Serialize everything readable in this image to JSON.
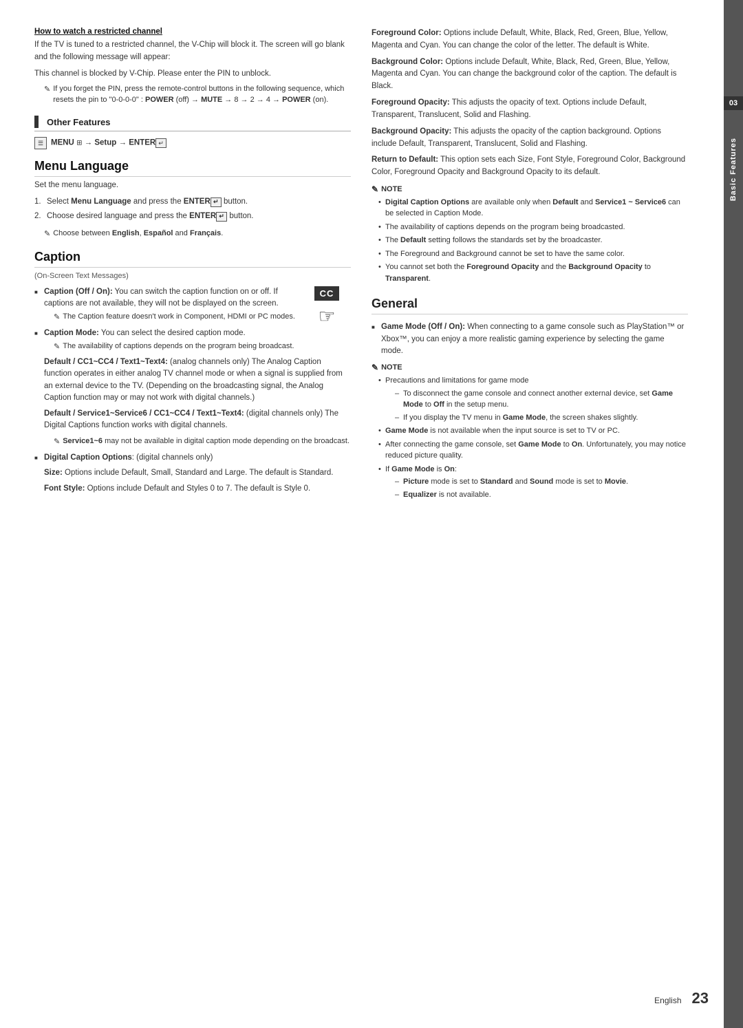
{
  "page": {
    "number": "23",
    "lang": "English",
    "chapter_number": "03",
    "chapter_title": "Basic Features"
  },
  "left_column": {
    "how_to_watch": {
      "heading": "How to watch a restricted channel",
      "para1": "If the TV is tuned to a restricted channel, the V-Chip will block it. The screen will go blank and the following message will appear:",
      "para2": "This channel is blocked by V-Chip. Please enter the PIN to unblock.",
      "note": "If you forget the PIN, press the remote-control buttons in the following sequence, which resets the pin to \"0-0-0-0\" : POWER (off) → MUTE → 8 → 2 → 4 → POWER (on)."
    },
    "other_features": {
      "title": "Other Features",
      "menu_nav": "MENU  → Setup → ENTER"
    },
    "menu_language": {
      "title": "Menu Language",
      "divider": true,
      "intro": "Set the menu language.",
      "steps": [
        {
          "number": "1",
          "text": "Select Menu Language and press the ENTER",
          "suffix": "button."
        },
        {
          "number": "2",
          "text": "Choose desired language and press the ENTER",
          "suffix": "button."
        }
      ],
      "note": "Choose between English, Español and Français."
    },
    "caption": {
      "title": "Caption",
      "subtitle": "(On-Screen Text Messages)",
      "items": [
        {
          "bold_part": "Caption (Off / On):",
          "text": " You can switch the caption function on or off. If captions are not available, they will not be displayed on the screen.",
          "note": "The Caption feature doesn't work in Component, HDMI or PC modes."
        },
        {
          "bold_part": "Caption Mode:",
          "text": " You can select the desired caption mode.",
          "note": "The availability of captions depends on the program being broadcast.",
          "extra_paras": [
            {
              "bold": "Default / CC1~CC4 / Text1~Text4:",
              "text": " (analog channels only) The Analog Caption function operates in either analog TV channel mode or when a signal is supplied from an external device to the TV. (Depending on the broadcasting signal, the Analog Caption function may or may not work with digital channels.)"
            },
            {
              "bold": "Default / Service1~Service6 / CC1~CC4 / Text1~Text4:",
              "text": " (digital channels only) The Digital Captions function works with digital channels.",
              "note2": "Service1~6 may not be available in digital caption mode depending on the broadcast."
            }
          ]
        },
        {
          "bold_part": "Digital Caption Options:",
          "text": " (digital channels only)",
          "extra_paras": [
            {
              "bold": "Size:",
              "text": " Options include Default, Small, Standard and Large. The default is Standard."
            },
            {
              "bold": "Font Style:",
              "text": " Options include Default and Styles 0 to 7. The default is Style 0."
            }
          ]
        }
      ],
      "cc_icon": {
        "label": "CC",
        "hand": "☞"
      }
    }
  },
  "right_column": {
    "caption_continued": {
      "paragraphs": [
        {
          "bold": "Foreground Color:",
          "text": " Options include Default, White, Black, Red, Green, Blue, Yellow, Magenta and Cyan. You can change the color of the letter. The default is White."
        },
        {
          "bold": "Background Color:",
          "text": " Options include Default, White, Black, Red, Green, Blue, Yellow, Magenta and Cyan. You can change the background color of the caption. The default is Black."
        },
        {
          "bold": "Foreground Opacity:",
          "text": " This adjusts the opacity of text. Options include Default, Transparent, Translucent, Solid and Flashing."
        },
        {
          "bold": "Background Opacity:",
          "text": " This adjusts the opacity of the caption background. Options include Default, Transparent, Translucent, Solid and Flashing."
        },
        {
          "bold": "Return to Default:",
          "text": " This option sets each Size, Font Style, Foreground Color, Background Color, Foreground Opacity and Background Opacity to its default."
        }
      ],
      "note_label": "NOTE",
      "notes": [
        {
          "text": "Digital Caption Options are available only when ",
          "bold_inline": "Default",
          "text2": " and ",
          "bold_inline2": "Service1 ~ Service6",
          "text3": " can be selected in Caption Mode."
        },
        {
          "text": "The availability of captions depends on the program being broadcasted."
        },
        {
          "text": "The ",
          "bold_inline": "Default",
          "text2": " setting follows the standards set by the broadcaster."
        },
        {
          "text": "The Foreground and Background cannot be set to have the same color."
        },
        {
          "text": "You cannot set both the ",
          "bold_inline": "Foreground Opacity",
          "text2": " and the ",
          "bold_inline2": "Background Opacity",
          "text3": " to ",
          "bold_inline3": "Transparent",
          "text4": "."
        }
      ]
    },
    "general": {
      "title": "General",
      "items": [
        {
          "bold_part": "Game Mode (Off / On):",
          "text": " When connecting to a game console such as PlayStation™ or Xbox™, you can enjoy a more realistic gaming experience by selecting the game mode."
        }
      ],
      "note_label": "NOTE",
      "notes_intro": "Precautions and limitations for game mode",
      "notes": [
        {
          "type": "dash_parent",
          "text": "To disconnect the game console and connect another external device, set ",
          "bold_inline": "Game Mode",
          "text2": " to ",
          "bold_inline2": "Off",
          "text3": " in the setup menu."
        },
        {
          "type": "dash_parent",
          "text": "If you display the TV menu in ",
          "bold_inline": "Game Mode",
          "text2": ", the screen shakes slightly."
        },
        {
          "type": "bullet",
          "text": "",
          "bold_inline": "Game Mode",
          "text2": " is not available when the input source is set to TV or PC."
        },
        {
          "type": "bullet",
          "text": "After connecting the game console, set ",
          "bold_inline": "Game Mode",
          "text2": " to ",
          "bold_inline2": "On",
          "text3": ". Unfortunately, you may notice reduced picture quality."
        },
        {
          "type": "bullet_if",
          "text": "If ",
          "bold_inline": "Game Mode",
          "text2": " is ",
          "bold_inline2": "On",
          "text3": ":"
        },
        {
          "type": "sub_dash",
          "text": "",
          "bold_inline": "Picture",
          "text2": " mode is set to ",
          "bold_inline2": "Standard",
          "text3": " and ",
          "bold_inline3": "Sound",
          "text4": " mode is set to ",
          "bold_inline4": "Movie",
          "text5": "."
        },
        {
          "type": "sub_dash",
          "text": "",
          "bold_inline": "Equalizer",
          "text2": " is not available."
        }
      ]
    }
  }
}
